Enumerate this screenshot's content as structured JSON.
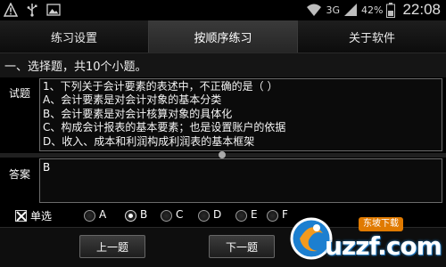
{
  "status_bar": {
    "signal_type": "3G",
    "battery": "42%",
    "time": "22:08",
    "icons": [
      "warning-icon",
      "usb-icon",
      "image-icon",
      "wifi-icon",
      "signal-icon",
      "battery-icon"
    ]
  },
  "tabs": [
    {
      "label": "练习设置",
      "active": false
    },
    {
      "label": "按顺序练习",
      "active": true
    },
    {
      "label": "关于软件",
      "active": false
    }
  ],
  "section_title": "一、选择题，共10个小题。",
  "question": {
    "label": "试题",
    "lines": [
      "1、下列关于会计要素的表述中，不正确的是（  ）",
      "A、会计要素是对会计对象的基本分类",
      "B、会计要素是对会计核算对象的具体化",
      "C、构成会计报表的基本要素；也是设置账户的依据",
      "D、收入、成本和利润构成利润表的基本框架"
    ]
  },
  "answer": {
    "label": "答案",
    "value": "B"
  },
  "mode": {
    "label": "单选",
    "checked": true
  },
  "options": [
    {
      "label": "A",
      "selected": false
    },
    {
      "label": "B",
      "selected": true
    },
    {
      "label": "C",
      "selected": false
    },
    {
      "label": "D",
      "selected": false
    },
    {
      "label": "E",
      "selected": false
    },
    {
      "label": "F",
      "selected": false
    }
  ],
  "buttons": {
    "prev": "上一题",
    "next": "下一题"
  },
  "watermark": {
    "top": "东坡下载",
    "brand": "uzzf.com"
  },
  "colors": {
    "background": "#000000",
    "active_tab": "#333333",
    "watermark_orange": "#e07a00",
    "watermark_blue": "#2a8ad0"
  }
}
